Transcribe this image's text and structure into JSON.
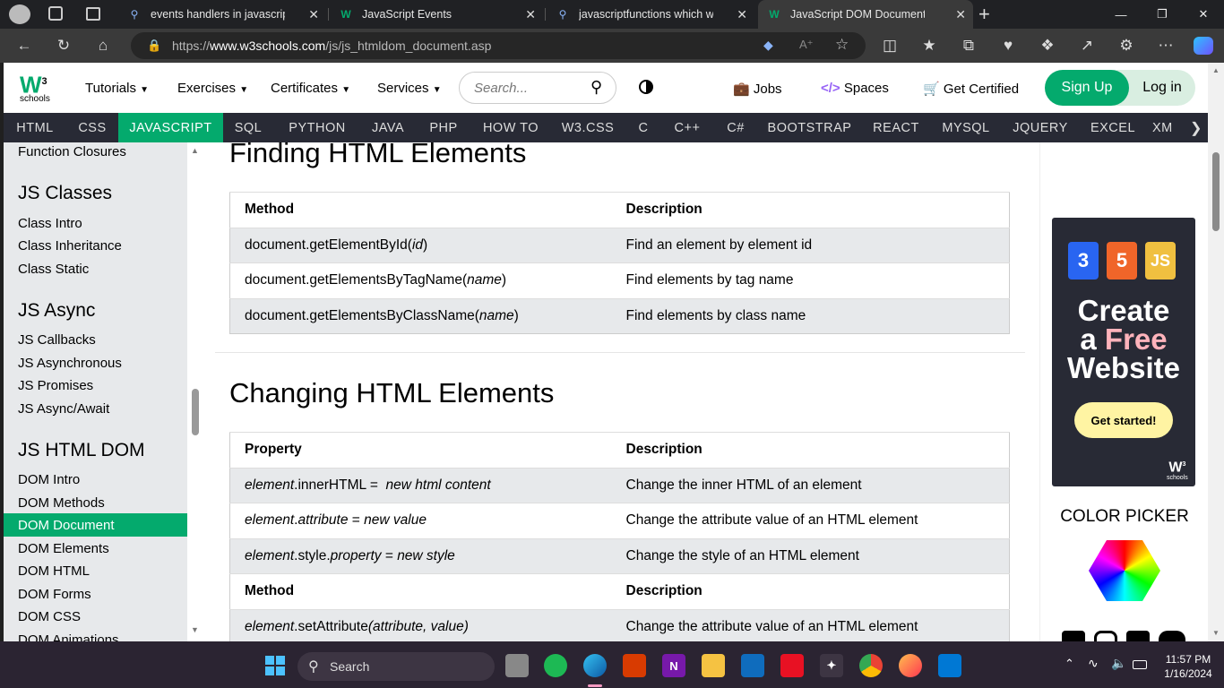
{
  "browser": {
    "tabs": [
      {
        "title": "events handlers in javascript list",
        "icon": "bing-search-icon",
        "active": false
      },
      {
        "title": "JavaScript Events",
        "icon": "w3schools-favicon",
        "active": false
      },
      {
        "title": "javascriptfunctions which work o",
        "icon": "bing-search-icon",
        "active": false
      },
      {
        "title": "JavaScript DOM Document",
        "icon": "w3schools-favicon",
        "active": true
      }
    ],
    "url_prefix": "https://",
    "url_host": "www.w3schools.com",
    "url_path": "/js/js_htmldom_document.asp"
  },
  "site": {
    "logo_text": "schools",
    "nav": [
      "Tutorials",
      "Exercises",
      "Certificates",
      "Services"
    ],
    "search_placeholder": "Search...",
    "jobs": "Jobs",
    "spaces": "Spaces",
    "get_certified": "Get Certified",
    "sign_up": "Sign Up",
    "log_in": "Log in",
    "topics": [
      "HTML",
      "CSS",
      "JAVASCRIPT",
      "SQL",
      "PYTHON",
      "JAVA",
      "PHP",
      "HOW TO",
      "W3.CSS",
      "C",
      "C++",
      "C#",
      "BOOTSTRAP",
      "REACT",
      "MYSQL",
      "JQUERY",
      "EXCEL",
      "XM"
    ],
    "active_topic": "JAVASCRIPT"
  },
  "sidebar": {
    "top_item": "Function Closures",
    "sections": [
      {
        "heading": "JS Classes",
        "items": [
          "Class Intro",
          "Class Inheritance",
          "Class Static"
        ]
      },
      {
        "heading": "JS Async",
        "items": [
          "JS Callbacks",
          "JS Asynchronous",
          "JS Promises",
          "JS Async/Await"
        ]
      },
      {
        "heading": "JS HTML DOM",
        "items": [
          "DOM Intro",
          "DOM Methods",
          "DOM Document",
          "DOM Elements",
          "DOM HTML",
          "DOM Forms",
          "DOM CSS",
          "DOM Animations"
        ]
      }
    ],
    "active_item": "DOM Document"
  },
  "main": {
    "finding": {
      "title": "Finding HTML Elements",
      "headers": [
        "Method",
        "Description"
      ],
      "rows": [
        [
          "document.getElementById(id)",
          "Find an element by element id"
        ],
        [
          "document.getElementsByTagName(name)",
          "Find elements by tag name"
        ],
        [
          "document.getElementsByClassName(name)",
          "Find elements by class name"
        ]
      ]
    },
    "changing": {
      "title": "Changing HTML Elements",
      "headers": [
        "Property",
        "Description"
      ],
      "rows": [
        [
          "element.innerHTML =  new html content",
          "Change the inner HTML of an element"
        ],
        [
          "element.attribute = new value",
          "Change the attribute value of an HTML element"
        ],
        [
          "element.style.property = new style",
          "Change the style of an HTML element"
        ]
      ],
      "headers2": [
        "Method",
        "Description"
      ],
      "rows2": [
        [
          "element.setAttribute(attribute, value)",
          "Change the attribute value of an HTML element"
        ]
      ]
    }
  },
  "ad": {
    "badges": [
      "3",
      "5",
      "JS"
    ],
    "line1": "Create",
    "line2a": "a ",
    "line2b": "Free",
    "line3": "Website",
    "button": "Get started!",
    "logo_sub": "schools"
  },
  "color_picker": "COLOR PICKER",
  "taskbar": {
    "search": "Search",
    "time": "11:57 PM",
    "date": "1/16/2024"
  },
  "colors": {
    "accent": "#04AA6D",
    "topic_bar": "#282A35",
    "sidebar": "#E7E9EB"
  }
}
